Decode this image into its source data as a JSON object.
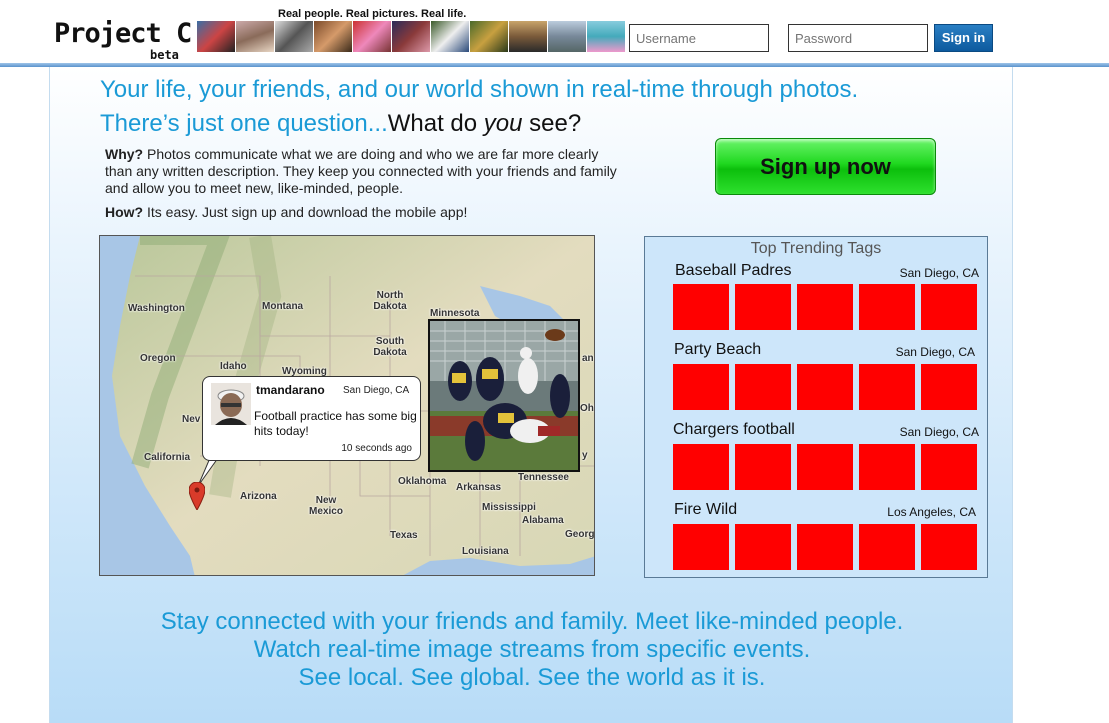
{
  "header": {
    "logo": "Project C",
    "logo_sub": "beta",
    "tagline": "Real people. Real pictures. Real life.",
    "username_placeholder": "Username",
    "password_placeholder": "Password",
    "signin_label": "Sign in"
  },
  "hero": {
    "headline1": "Your life, your friends, and our world shown in real-time through photos.",
    "headline2_prefix": "There’s just one question...",
    "headline2_q1": "What do ",
    "headline2_q_em": "you",
    "headline2_q2": " see?",
    "why_label": "Why?",
    "why_text": " Photos communicate what we are doing and who we are far more clearly than any written description. They keep you connected with your friends and family and allow you to meet new, like-minded, people.",
    "how_label": "How?",
    "how_text": " Its easy. Just sign up and download the mobile app!",
    "signup_label": "Sign up now"
  },
  "map": {
    "labels": {
      "washington": "Washington",
      "montana": "Montana",
      "north_dakota": "North Dakota",
      "minnesota": "Minnesota",
      "south_dakota": "South Dakota",
      "oregon": "Oregon",
      "idaho": "Idaho",
      "wyoming": "Wyoming",
      "nevada": "Nev",
      "california": "California",
      "arizona": "Arizona",
      "new_mexico": "New Mexico",
      "texas": "Texas",
      "oklahoma": "Oklahoma",
      "arkansas": "Arkansas",
      "tennessee": "Tennessee",
      "mississippi": "Mississippi",
      "alabama": "Alabama",
      "louisiana": "Louisiana",
      "georgia": "Georg",
      "ohio": "Ohi",
      "michigan": "an",
      "kentucky": "y"
    },
    "post": {
      "user": "tmandarano",
      "location": "San Diego, CA",
      "message": "Football practice has some big hits today!",
      "time": "10 seconds ago"
    }
  },
  "trending": {
    "title": "Top Trending Tags",
    "tags": [
      {
        "name": "Baseball Padres",
        "location": "San Diego, CA"
      },
      {
        "name": "Party Beach",
        "location": "San Diego, CA"
      },
      {
        "name": "Chargers football",
        "location": "San Diego, CA"
      },
      {
        "name": "Fire Wild",
        "location": "Los Angeles, CA"
      }
    ],
    "tile_color": "#ff0000"
  },
  "footer": {
    "line1": "Stay connected with your friends and family. Meet like-minded people.",
    "line2": "Watch real-time image streams from specific events.",
    "line3": "See local. See global. See the world as it is."
  },
  "colors": {
    "accent": "#1a9ad6",
    "signup_green": "#1fd81f",
    "signin_blue": "#0d5a9e"
  }
}
